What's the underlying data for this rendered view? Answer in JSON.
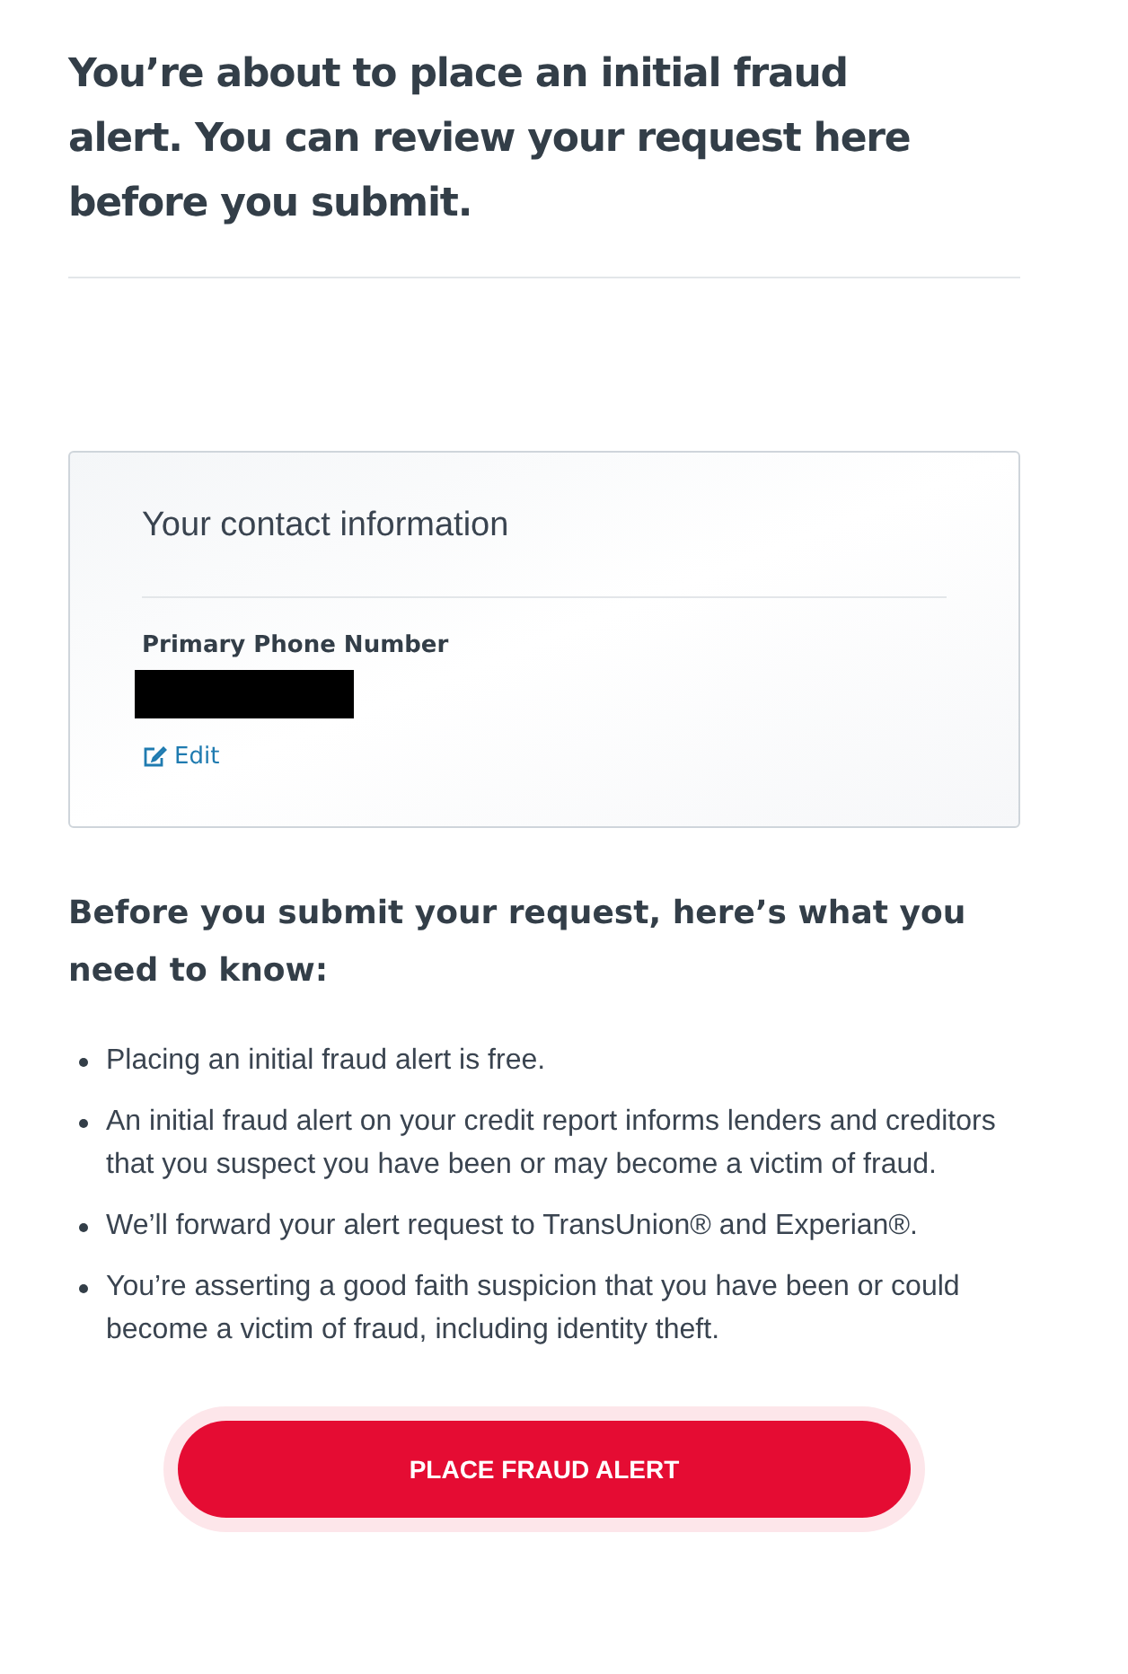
{
  "heading": "You’re about to place an initial fraud alert. You can review your request here before you submit.",
  "contact_card": {
    "title": "Your contact information",
    "field_label": "Primary Phone Number",
    "value_redacted": true,
    "edit_link": "Edit"
  },
  "notice_heading": "Before you submit your request, here’s what you need to know:",
  "notice_items": [
    "Placing an initial fraud alert is free.",
    "An initial fraud alert on your credit report informs lenders and creditors that you suspect you have been or may become a victim of fraud.",
    "We’ll forward your alert request to TransUnion® and Experian®.",
    "You’re asserting a good faith suspicion that you have been or could become a victim of fraud, including identity theft."
  ],
  "submit_button": "PLACE FRAUD ALERT"
}
